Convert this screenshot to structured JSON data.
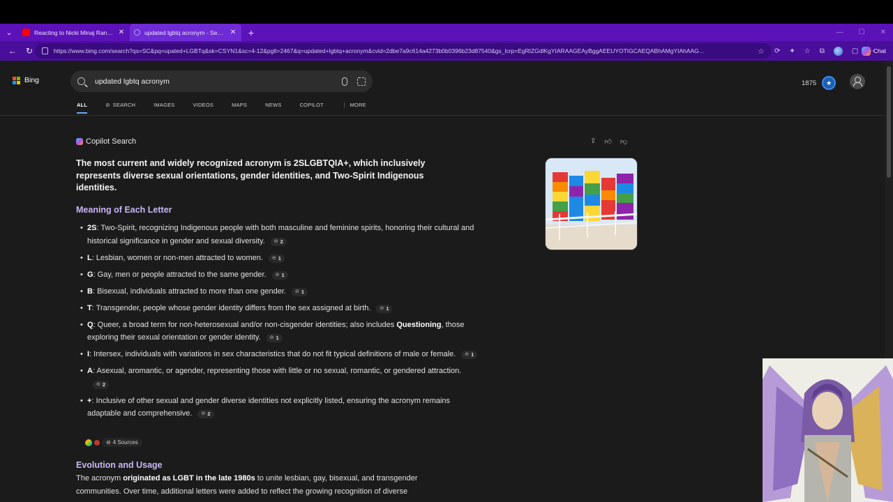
{
  "browser": {
    "tabs": [
      {
        "title": "Reacting to Nicki Minaj Rant About",
        "favicon_color": "#ff0000",
        "active": false
      },
      {
        "title": "updated lgbtq acronym - Search",
        "favicon_color": "#7d5cff",
        "active": true
      }
    ],
    "new_tab_symbol": "+",
    "url": "https://www.bing.com/search?qs=SC&pq=upated+LGBTq&sk=CSYN1&sc=4-12&pglt=2467&q=updated+lgbtq+acronym&cvid=2dbe7a9c614a4273b0b0396b23d87540&gs_lcrp=EgRIZGdlKgYIARAAGEAyBggAEEUYOTIGCAEQABhAMgYIAhAAG...",
    "chat_label": "Chat"
  },
  "header": {
    "brand": "Bing",
    "search_query": "updated lgbtq acronym",
    "points": "1875",
    "scopes": [
      "ALL",
      "SEARCH",
      "IMAGES",
      "VIDEOS",
      "MAPS",
      "NEWS",
      "COPILOT",
      "MORE"
    ],
    "active_scope": "ALL"
  },
  "answer": {
    "heading": "Copilot Search",
    "summary": "The most current and widely recognized acronym is 2SLGBTQIA+, which inclusively represents diverse sexual orientations, gender identities, and Two-Spirit Indigenous identities.",
    "meaning_heading": "Meaning of Each Letter",
    "letters": [
      {
        "key": "2S",
        "text": ": Two-Spirit, recognizing Indigenous people with both masculine and feminine spirits, honoring their cultural and historical significance in gender and sexual diversity.",
        "cite": "2"
      },
      {
        "key": "L",
        "text": ": Lesbian, women or non-men attracted to women.",
        "cite": "1"
      },
      {
        "key": "G",
        "text": ": Gay, men or people attracted to the same gender.",
        "cite": "1"
      },
      {
        "key": "B",
        "text": ": Bisexual, individuals attracted to more than one gender.",
        "cite": "1"
      },
      {
        "key": "T",
        "text": ": Transgender, people whose gender identity differs from the sex assigned at birth.",
        "cite": "1"
      },
      {
        "key": "Q",
        "text": ": Queer, a broad term for non-heterosexual and/or non-cisgender identities; also includes ",
        "bold2": "Questioning",
        "text2": ", those exploring their sexual orientation or gender identity.",
        "cite": "1"
      },
      {
        "key": "I",
        "text": ": Intersex, individuals with variations in sex characteristics that do not fit typical definitions of male or female.",
        "cite": "1"
      },
      {
        "key": "A",
        "text": ": Asexual, aromantic, or agender, representing those with little or no sexual, romantic, or gendered attraction.",
        "cite": "2"
      },
      {
        "key": "+",
        "text": ": Inclusive of other sexual and gender diverse identities not explicitly listed, ensuring the acronym remains adaptable and comprehensive.",
        "cite": "2"
      }
    ],
    "sources_label": "4 Sources",
    "evolution_heading": "Evolution and Usage",
    "evolution_pre": "The acronym ",
    "evolution_bold": "originated as LGBT in the late 1980s",
    "evolution_post": " to unite lesbian, gay, bisexual, and transgender communities. Over time, additional letters were added to reflect the growing recognition of diverse"
  },
  "colors": {
    "tabstrip": "#5b12b8",
    "addressbar": "#4a0f9a",
    "page_bg": "#1b1b1b",
    "section_heading": "#c9b6f6"
  }
}
